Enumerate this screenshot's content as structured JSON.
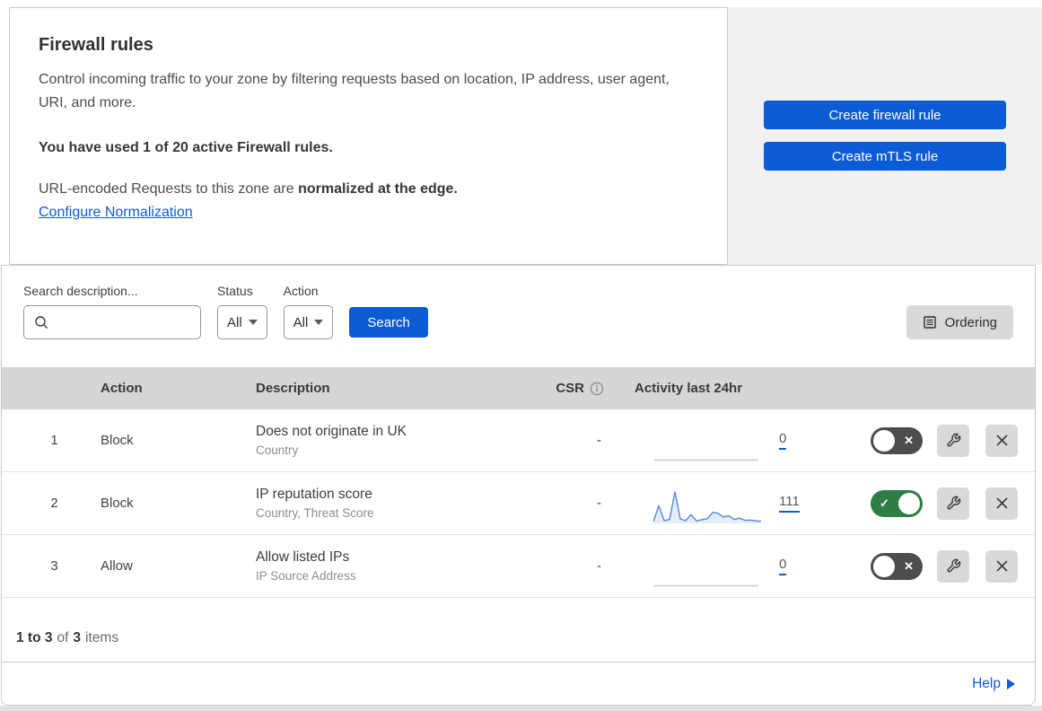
{
  "intro": {
    "title": "Firewall rules",
    "description": "Control incoming traffic to your zone by filtering requests based on location, IP address, user agent, URI, and more.",
    "usage": "You have used 1 of 20 active Firewall rules.",
    "normalization_text": "URL-encoded Requests to this zone are ",
    "normalization_bold": "normalized at the edge.",
    "configure_link": "Configure Normalization"
  },
  "actions": {
    "create_firewall_rule": "Create firewall rule",
    "create_mtls_rule": "Create mTLS rule"
  },
  "filters": {
    "search_label": "Search description...",
    "search_value": "",
    "status_label": "Status",
    "status_value": "All",
    "action_label": "Action",
    "action_value": "All",
    "search_button": "Search",
    "ordering_button": "Ordering"
  },
  "table": {
    "headers": {
      "action": "Action",
      "description": "Description",
      "csr": "CSR",
      "activity": "Activity last 24hr"
    },
    "rows": [
      {
        "index": "1",
        "action": "Block",
        "description": "Does not originate in UK",
        "fields": "Country",
        "csr": "-",
        "activity_count": "0",
        "enabled": false,
        "sparkline": []
      },
      {
        "index": "2",
        "action": "Block",
        "description": "IP reputation score",
        "fields": "Country, Threat Score",
        "csr": "-",
        "activity_count": "111",
        "enabled": true,
        "sparkline": [
          3,
          55,
          6,
          10,
          100,
          12,
          6,
          26,
          5,
          9,
          12,
          33,
          30,
          18,
          22,
          10,
          14,
          7,
          8,
          5,
          4
        ]
      },
      {
        "index": "3",
        "action": "Allow",
        "description": "Allow listed IPs",
        "fields": "IP Source Address",
        "csr": "-",
        "activity_count": "0",
        "enabled": false,
        "sparkline": []
      }
    ]
  },
  "footer": {
    "range": "1 to 3",
    "of": "of",
    "total": "3",
    "items": "items"
  },
  "help": {
    "label": "Help"
  },
  "colors": {
    "primary_blue": "#0b5cd5",
    "toggle_on_green": "#2e7d44",
    "toggle_off_gray": "#4d4d4d",
    "sparkline_blue": "#5b8fd9",
    "sparkline_fill": "rgba(91,143,217,0.16)",
    "empty_sparkline_gray": "#c9c9c9"
  }
}
